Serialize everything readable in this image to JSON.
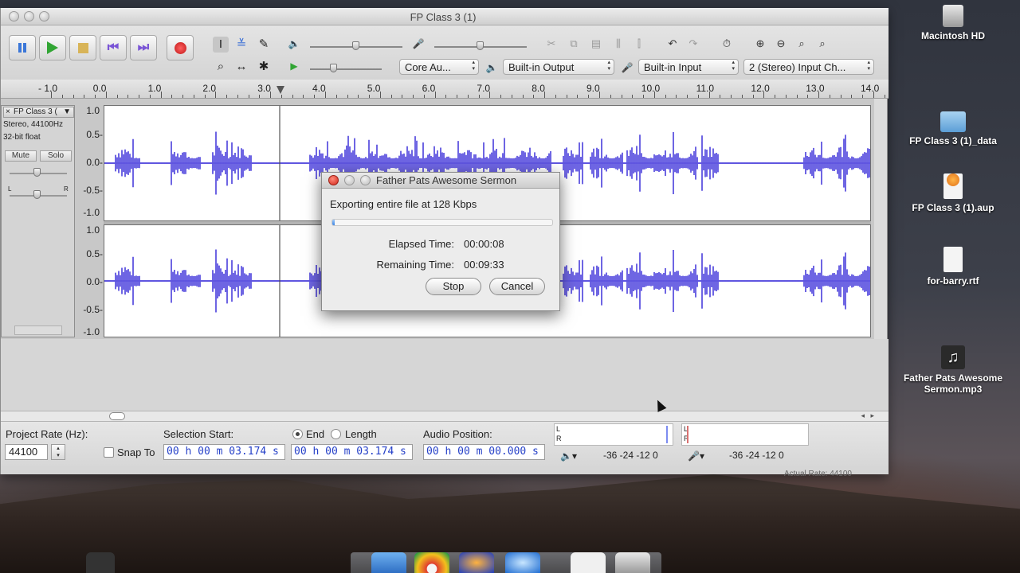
{
  "window": {
    "title": "FP Class 3 (1)"
  },
  "toolbar": {
    "host_select": "Core Au...",
    "output_select": "Built-in Output",
    "input_select": "Built-in Input",
    "channels_select": "2 (Stereo) Input Ch..."
  },
  "ruler": {
    "labels": [
      "- 1.0",
      "0.0",
      "1.0",
      "2.0",
      "3.0",
      "4.0",
      "5.0",
      "6.0",
      "7.0",
      "8.0",
      "9.0",
      "10.0",
      "11.0",
      "12.0",
      "13.0",
      "14.0"
    ]
  },
  "track": {
    "name": "FP Class 3 (",
    "format": "Stereo, 44100Hz",
    "bitdepth": "32-bit float",
    "mute": "Mute",
    "solo": "Solo",
    "pan_l": "L",
    "pan_r": "R",
    "scale": [
      "1.0",
      "0.5-",
      "0.0-",
      "-0.5-",
      "-1.0"
    ],
    "scale2": [
      "1.0",
      "0.5-",
      "0.0-",
      "-0.5-",
      "-1.0"
    ],
    "wave_color": "#4a3fdc"
  },
  "selection_bar": {
    "project_rate_label": "Project Rate (Hz):",
    "project_rate": "44100",
    "snap_to": "Snap To",
    "selection_start_label": "Selection Start:",
    "end_label": "End",
    "length_label": "Length",
    "audio_position_label": "Audio Position:",
    "start_value": "00 h 00 m 03.174 s",
    "end_value": "00 h 00 m 03.174 s",
    "position_value": "00 h 00 m 00.000 s",
    "meter_l": "L",
    "meter_r": "R",
    "meter_scale_out": "-36  -24  -12  0",
    "meter_scale_in": "-36  -24  -12  0",
    "actual_rate": "Actual Rate: 44100"
  },
  "dialog": {
    "title": "Father Pats Awesome Sermon",
    "message": "Exporting entire file at 128 Kbps",
    "progress_fraction": 0.01,
    "elapsed_label": "Elapsed Time:",
    "elapsed_value": "00:00:08",
    "remaining_label": "Remaining Time:",
    "remaining_value": "00:09:33",
    "stop": "Stop",
    "cancel": "Cancel"
  },
  "desktop": {
    "icons": [
      {
        "label": "Macintosh HD"
      },
      {
        "label": "FP Class 3 (1)_data"
      },
      {
        "label": "FP Class 3 (1).aup"
      },
      {
        "label": "for-barry.rtf"
      },
      {
        "label": "Father Pats Awesome Sermon.mp3"
      }
    ]
  }
}
